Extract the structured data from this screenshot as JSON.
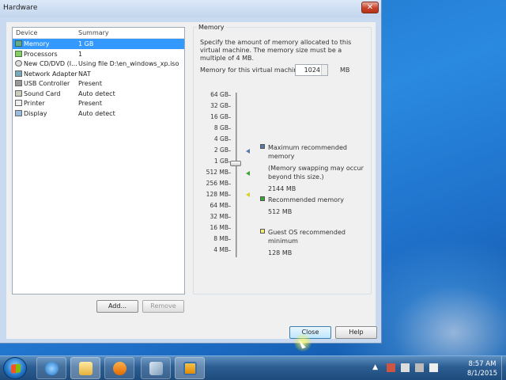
{
  "window": {
    "title": "Hardware",
    "close_glyph": "✕"
  },
  "device_list": {
    "headers": {
      "device": "Device",
      "summary": "Summary"
    },
    "rows": [
      {
        "icon": "memory-icon",
        "name": "Memory",
        "summary": "1 GB",
        "selected": true
      },
      {
        "icon": "processor-icon",
        "name": "Processors",
        "summary": "1",
        "selected": false
      },
      {
        "icon": "cd-dvd-icon",
        "name": "New CD/DVD (I...",
        "summary": "Using file D:\\en_windows_xp.iso",
        "selected": false
      },
      {
        "icon": "network-adapter-icon",
        "name": "Network Adapter",
        "summary": "NAT",
        "selected": false
      },
      {
        "icon": "usb-icon",
        "name": "USB Controller",
        "summary": "Present",
        "selected": false
      },
      {
        "icon": "sound-card-icon",
        "name": "Sound Card",
        "summary": "Auto detect",
        "selected": false
      },
      {
        "icon": "printer-icon",
        "name": "Printer",
        "summary": "Present",
        "selected": false
      },
      {
        "icon": "display-icon",
        "name": "Display",
        "summary": "Auto detect",
        "selected": false
      }
    ]
  },
  "buttons": {
    "add": "Add...",
    "remove": "Remove",
    "close": "Close",
    "help": "Help"
  },
  "memory": {
    "group_label": "Memory",
    "description": "Specify the amount of memory allocated to this virtual machine. The memory size must be a multiple of 4 MB.",
    "field_label": "Memory for this virtual machine:",
    "value": "1024",
    "unit": "MB",
    "scale": [
      "64 GB",
      "32 GB",
      "16 GB",
      "8 GB",
      "4 GB",
      "2 GB",
      "1 GB",
      "512 MB",
      "256 MB",
      "128 MB",
      "64 MB",
      "32 MB",
      "16 MB",
      "8 MB",
      "4 MB"
    ],
    "legend": {
      "max_label": "Maximum recommended memory",
      "max_note": "(Memory swapping may occur beyond this size.)",
      "max_value": "2144 MB",
      "rec_label": "Recommended memory",
      "rec_value": "512 MB",
      "min_label": "Guest OS recommended minimum",
      "min_value": "128 MB"
    },
    "colors": {
      "max": "#5a78a8",
      "rec": "#3aa536",
      "min": "#d7d227"
    }
  },
  "taskbar": {
    "apps": [
      "start-orb",
      "internet-explorer-icon",
      "file-explorer-icon",
      "media-player-icon",
      "vm-icon",
      "vmware-icon"
    ],
    "clock_time": "8:57 AM",
    "clock_date": "8/1/2015"
  }
}
